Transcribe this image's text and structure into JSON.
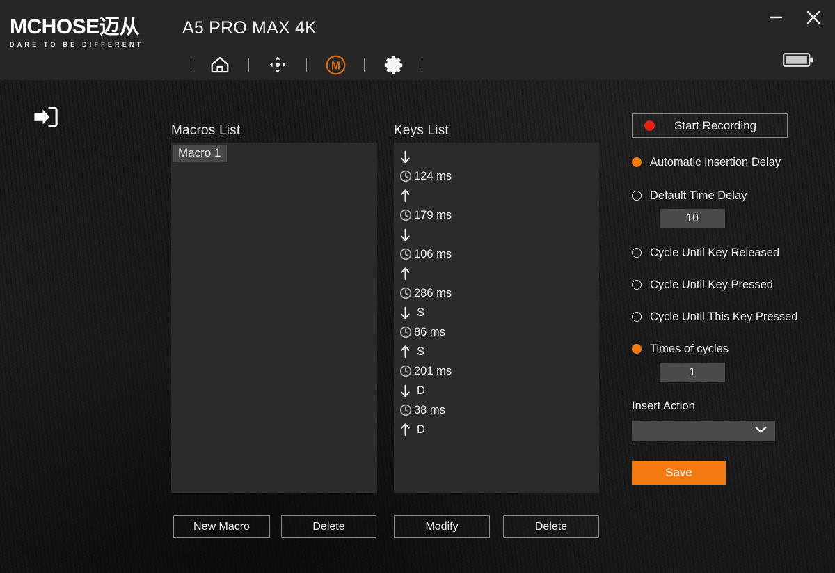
{
  "header": {
    "logo_main": "MCHOSE",
    "logo_cn": "迈从",
    "logo_tagline": "DARE TO BE DIFFERENT",
    "device_title": "A5 PRO MAX 4K",
    "nav": [
      {
        "name": "home-icon",
        "label": "Home",
        "active": false
      },
      {
        "name": "dpi-icon",
        "label": "DPI Settings",
        "active": false
      },
      {
        "name": "macro-icon",
        "label": "Macro",
        "active": true
      },
      {
        "name": "gear-icon",
        "label": "Settings",
        "active": false
      }
    ],
    "window": {
      "minimize": "−",
      "close": "✕",
      "battery_icon": "battery-full-icon"
    }
  },
  "back_button": {
    "icon": "back-arrow-icon",
    "label": "Back"
  },
  "macros": {
    "title": "Macros List",
    "items": [
      {
        "label": "Macro 1",
        "selected": true
      }
    ]
  },
  "keys": {
    "title": "Keys List",
    "items": [
      {
        "type": "keydown",
        "icon": "arrow-down-icon",
        "label": ""
      },
      {
        "type": "delay",
        "icon": "clock-icon",
        "label": "124 ms"
      },
      {
        "type": "keyup",
        "icon": "arrow-up-icon",
        "label": ""
      },
      {
        "type": "delay",
        "icon": "clock-icon",
        "label": "179 ms"
      },
      {
        "type": "keydown",
        "icon": "arrow-down-icon",
        "label": ""
      },
      {
        "type": "delay",
        "icon": "clock-icon",
        "label": "106 ms"
      },
      {
        "type": "keyup",
        "icon": "arrow-up-icon",
        "label": ""
      },
      {
        "type": "delay",
        "icon": "clock-icon",
        "label": "286 ms"
      },
      {
        "type": "keydown",
        "icon": "arrow-down-icon",
        "label": "S"
      },
      {
        "type": "delay",
        "icon": "clock-icon",
        "label": "86 ms"
      },
      {
        "type": "keyup",
        "icon": "arrow-up-icon",
        "label": "S"
      },
      {
        "type": "delay",
        "icon": "clock-icon",
        "label": "201 ms"
      },
      {
        "type": "keydown",
        "icon": "arrow-down-icon",
        "label": "D"
      },
      {
        "type": "delay",
        "icon": "clock-icon",
        "label": "38 ms"
      },
      {
        "type": "keyup",
        "icon": "arrow-up-icon",
        "label": "D"
      }
    ]
  },
  "buttons": {
    "new_macro": "New Macro",
    "delete_macro": "Delete",
    "modify_key": "Modify",
    "delete_key": "Delete"
  },
  "options": {
    "start_recording": "Start Recording",
    "record_dot_color": "#e81f12",
    "radios": [
      {
        "label": "Automatic Insertion Delay",
        "selected": true
      },
      {
        "label": "Default Time Delay",
        "selected": false
      },
      {
        "label": "Cycle Until Key Released",
        "selected": false
      },
      {
        "label": "Cycle Until Key Pressed",
        "selected": false
      },
      {
        "label": "Cycle Until This Key Pressed",
        "selected": false
      },
      {
        "label": "Times of cycles",
        "selected": true
      }
    ],
    "default_time_delay_value": "10",
    "times_of_cycles_value": "1",
    "insert_action_label": "Insert Action",
    "insert_action_value": "",
    "save_label": "Save",
    "accent_color": "#f27a11"
  }
}
